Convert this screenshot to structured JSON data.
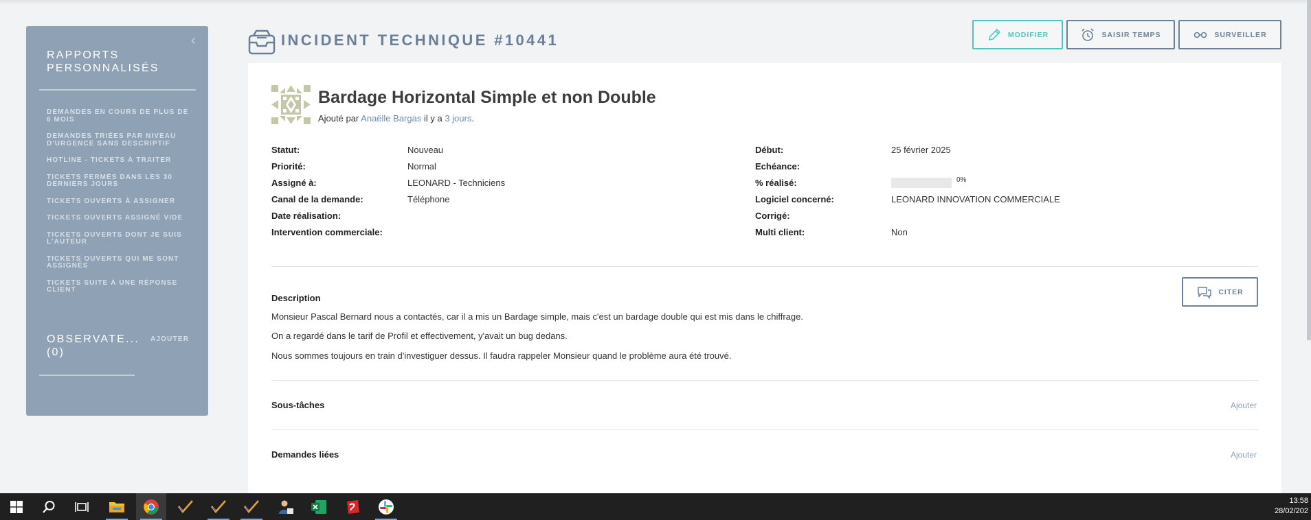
{
  "sidebar": {
    "section_title": "RAPPORTS PERSONNALISÉS",
    "items": [
      {
        "label": "DEMANDES EN COURS DE PLUS DE 6 MOIS"
      },
      {
        "label": "DEMANDES TRIÉES PAR NIVEAU D'URGENCE SANS DESCRIPTIF"
      },
      {
        "label": "HOTLINE - TICKETS À TRAITER"
      },
      {
        "label": "TICKETS FERMÉS DANS LES 30 DERNIERS JOURS"
      },
      {
        "label": "TICKETS OUVERTS À ASSIGNER"
      },
      {
        "label": "TICKETS OUVERTS ASSIGNÉ VIDE"
      },
      {
        "label": "TICKETS OUVERTS DONT JE SUIS L'AUTEUR"
      },
      {
        "label": "TICKETS OUVERTS QUI ME SONT ASSIGNÉS"
      },
      {
        "label": "TICKETS SUITE À UNE RÉPONSE CLIENT"
      }
    ],
    "observateurs_title": "OBSERVATE... (0)",
    "observateurs_add": "AJOUTER"
  },
  "header": {
    "title": "INCIDENT TECHNIQUE #10441",
    "buttons": {
      "modifier": "MODIFIER",
      "saisir_temps": "SAISIR TEMPS",
      "surveiller": "SURVEILLER"
    }
  },
  "ticket": {
    "title": "Bardage Horizontal Simple et non Double",
    "meta_prefix": "Ajouté par",
    "author": "Anaëlle Bargas",
    "meta_mid": "il y a",
    "age": "3 jours",
    "meta_suffix": ".",
    "fields_left": [
      {
        "label": "Statut:",
        "value": "Nouveau"
      },
      {
        "label": "Priorité:",
        "value": "Normal"
      },
      {
        "label": "Assigné à:",
        "value": "LEONARD - Techniciens"
      },
      {
        "label": "Canal de la demande:",
        "value": "Téléphone"
      },
      {
        "label": "Date réalisation:",
        "value": ""
      },
      {
        "label": "Intervention commerciale:",
        "value": ""
      }
    ],
    "fields_right": {
      "debut": {
        "label": "Début:",
        "value": "25 février 2025"
      },
      "echeance": {
        "label": "Echéance:",
        "value": ""
      },
      "realise": {
        "label": "% réalisé:",
        "value": "0%",
        "progress": 0
      },
      "logiciel": {
        "label": "Logiciel concerné:",
        "value": "LEONARD INNOVATION COMMERCIALE"
      },
      "corrige": {
        "label": "Corrigé:",
        "value": ""
      },
      "multi": {
        "label": "Multi client:",
        "value": "Non"
      }
    },
    "citer_label": "CITER",
    "description_title": "Description",
    "description": [
      "Monsieur Pascal Bernard nous a contactés, car il a mis un Bardage simple, mais c'est un bardage double qui est mis dans le chiffrage.",
      "On a regardé dans le tarif de Profil et effectivement, y'avait un bug dedans.",
      "Nous sommes toujours en train d'investiguer dessus. Il faudra rappeler Monsieur quand le problème aura été trouvé."
    ],
    "subtasks_title": "Sous-tâches",
    "subtasks_add": "Ajouter",
    "related_title": "Demandes liées",
    "related_add": "Ajouter"
  },
  "taskbar": {
    "time": "13:58",
    "date": "28/02/202"
  },
  "colors": {
    "sidebar_bg": "#8fa1b5",
    "accent_teal": "#4fc7c0",
    "button_border": "#6b8196",
    "taskbar_bg": "#202020"
  }
}
